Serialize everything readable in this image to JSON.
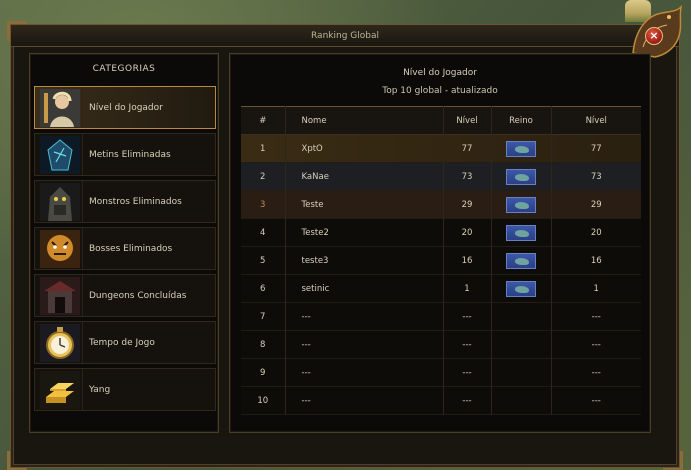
{
  "window": {
    "title": "Ranking Global",
    "close_label": "×"
  },
  "sidebar": {
    "title": "CATEGORIAS",
    "items": [
      {
        "label": "Nível do Jogador",
        "icon": "player-portrait-icon",
        "active": true
      },
      {
        "label": "Metins Eliminadas",
        "icon": "metin-stone-icon",
        "active": false
      },
      {
        "label": "Monstros Eliminados",
        "icon": "monster-icon",
        "active": false
      },
      {
        "label": "Bosses Eliminados",
        "icon": "tiger-boss-icon",
        "active": false
      },
      {
        "label": "Dungeons Concluídas",
        "icon": "dungeon-gate-icon",
        "active": false
      },
      {
        "label": "Tempo de Jogo",
        "icon": "pocket-watch-icon",
        "active": false
      },
      {
        "label": "Yang",
        "icon": "gold-bars-icon",
        "active": false
      }
    ]
  },
  "main": {
    "title": "Nível do Jogador",
    "subtitle": "Top 10 global - atualizado",
    "columns": [
      "#",
      "Nome",
      "Nível",
      "Reino",
      "Nível"
    ],
    "rows": [
      {
        "pos": "1",
        "name": "XptO",
        "level": "77",
        "flag": true,
        "level2": "77"
      },
      {
        "pos": "2",
        "name": "KaNae",
        "level": "73",
        "flag": true,
        "level2": "73"
      },
      {
        "pos": "3",
        "name": "Teste",
        "level": "29",
        "flag": true,
        "level2": "29"
      },
      {
        "pos": "4",
        "name": "Teste2",
        "level": "20",
        "flag": true,
        "level2": "20"
      },
      {
        "pos": "5",
        "name": "teste3",
        "level": "16",
        "flag": true,
        "level2": "16"
      },
      {
        "pos": "6",
        "name": "setinic",
        "level": "1",
        "flag": true,
        "level2": "1"
      },
      {
        "pos": "7",
        "name": "---",
        "level": "---",
        "flag": false,
        "level2": "---"
      },
      {
        "pos": "8",
        "name": "---",
        "level": "---",
        "flag": false,
        "level2": "---"
      },
      {
        "pos": "9",
        "name": "---",
        "level": "---",
        "flag": false,
        "level2": "---"
      },
      {
        "pos": "10",
        "name": "---",
        "level": "---",
        "flag": false,
        "level2": "---"
      }
    ]
  },
  "colors": {
    "accent_gold": "#b78a3e",
    "panel_bg": "#0b0a08",
    "close_red": "#a4231a",
    "flag_blue": "#3b58a8"
  }
}
